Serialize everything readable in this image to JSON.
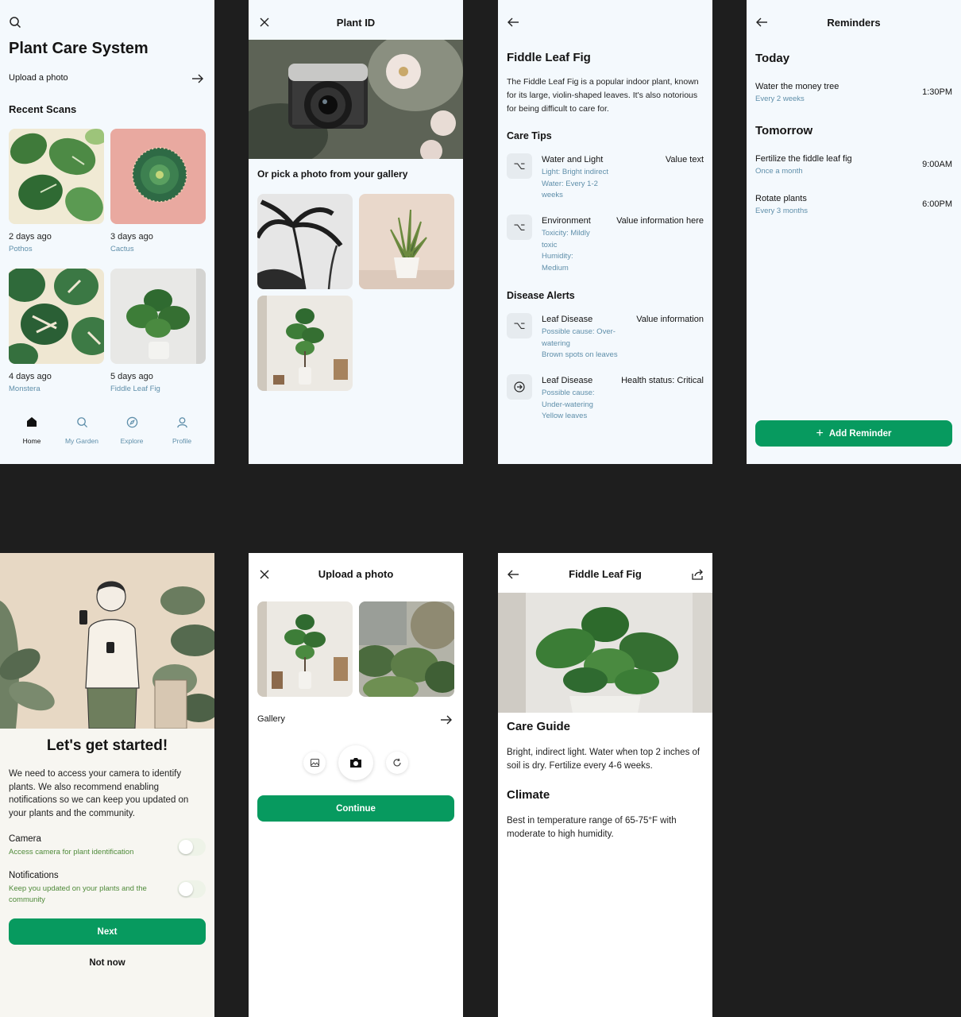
{
  "home": {
    "title": "Plant Care System",
    "upload_label": "Upload a photo",
    "recent_label": "Recent Scans",
    "scans": [
      {
        "date": "2 days ago",
        "name": "Pothos"
      },
      {
        "date": "3 days ago",
        "name": "Cactus"
      },
      {
        "date": "4 days ago",
        "name": "Monstera"
      },
      {
        "date": "5 days ago",
        "name": "Fiddle Leaf Fig"
      }
    ],
    "nav": [
      {
        "label": "Home",
        "icon": "home-icon"
      },
      {
        "label": "My Garden",
        "icon": "search-icon"
      },
      {
        "label": "Explore",
        "icon": "compass-icon"
      },
      {
        "label": "Profile",
        "icon": "user-icon"
      }
    ]
  },
  "plant_id": {
    "title": "Plant ID",
    "gallery_label": "Or pick a photo from your gallery"
  },
  "detail": {
    "title": "Fiddle Leaf Fig",
    "description": "The Fiddle Leaf Fig is a popular indoor plant, known for its large, violin-shaped leaves. It's also notorious for being difficult to care for.",
    "care_tips_label": "Care Tips",
    "tips": [
      {
        "title": "Water and Light",
        "lines": [
          "Light: Bright indirect",
          "Water: Every 1-2",
          "weeks"
        ],
        "value": "Value text"
      },
      {
        "title": "Environment",
        "lines": [
          "Toxicity: Mildly",
          "toxic",
          "Humidity:",
          "Medium"
        ],
        "value": "Value information here"
      }
    ],
    "disease_label": "Disease Alerts",
    "alerts": [
      {
        "title": "Leaf Disease",
        "lines": [
          "Possible cause: Over-",
          "watering",
          "Brown spots on leaves"
        ],
        "value": "Value information"
      },
      {
        "title": "Leaf Disease",
        "lines": [
          "Possible cause:",
          "Under-watering",
          "Yellow leaves"
        ],
        "value": "Health status: Critical"
      }
    ]
  },
  "reminders": {
    "title": "Reminders",
    "today_label": "Today",
    "today": [
      {
        "title": "Water the money tree",
        "sub": "Every 2 weeks",
        "time": "1:30PM"
      }
    ],
    "tomorrow_label": "Tomorrow",
    "tomorrow": [
      {
        "title": "Fertilize the fiddle leaf fig",
        "sub": "Once a month",
        "time": "9:00AM"
      },
      {
        "title": "Rotate plants",
        "sub": "Every 3 months",
        "time": "6:00PM"
      }
    ],
    "add_label": "Add Reminder"
  },
  "onboarding": {
    "heading": "Let's get started!",
    "body": "We need to access your camera to identify plants. We also recommend enabling notifications so we can keep you updated on your plants and the community.",
    "camera_label": "Camera",
    "camera_sub": "Access camera for plant identification",
    "notif_label": "Notifications",
    "notif_sub": "Keep you updated on your plants and the community",
    "next_label": "Next",
    "not_now_label": "Not now"
  },
  "upload": {
    "title": "Upload a photo",
    "gallery_label": "Gallery",
    "continue_label": "Continue"
  },
  "care_guide": {
    "title": "Fiddle Leaf Fig",
    "guide_heading": "Care Guide",
    "guide_text": "Bright, indirect light. Water when top 2 inches of soil is dry. Fertilize every 4-6 weeks.",
    "climate_heading": "Climate",
    "climate_text": "Best in temperature range of 65-75°F with moderate to high humidity."
  },
  "colors": {
    "accent": "#079a5f",
    "muted_blue": "#5f8faa",
    "green_text": "#4f8a3a"
  }
}
